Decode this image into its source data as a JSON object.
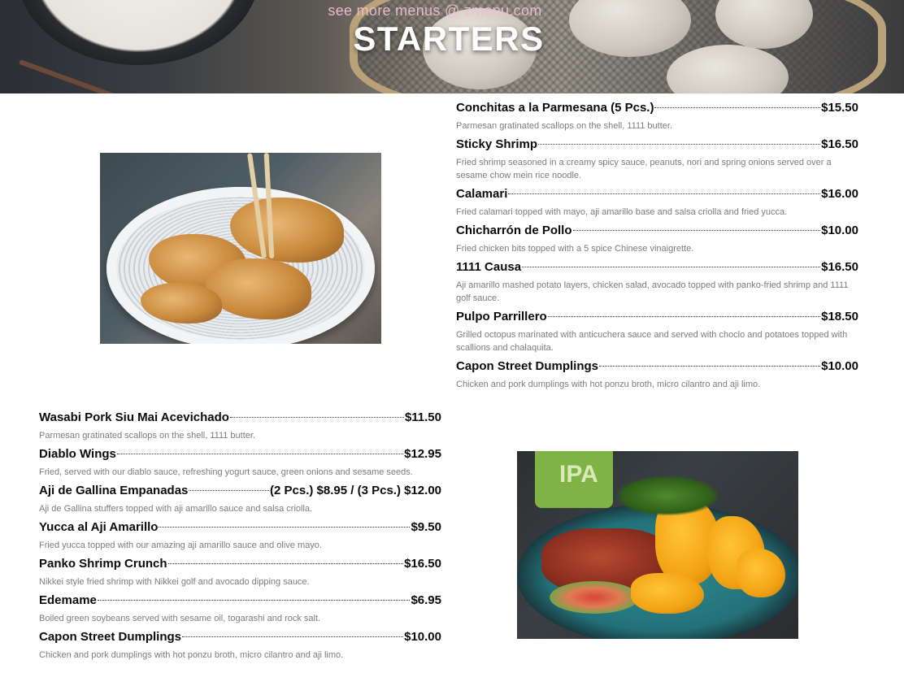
{
  "header": {
    "watermark": "see more menus @ zmenu.com",
    "title": "STARTERS"
  },
  "right_menu": [
    {
      "name": "Conchitas a la Parmesana (5 Pcs.)",
      "price": "$15.50",
      "desc": "Parmesan gratinated scallops on the shell, 1111 butter."
    },
    {
      "name": "Sticky Shrimp",
      "price": "$16.50",
      "desc": "Fried shrimp seasoned in a creamy spicy sauce, peanuts, nori and spring onions served over a sesame chow mein rice noodle."
    },
    {
      "name": "Calamari",
      "price": "$16.00",
      "desc": "Fried calamari topped with mayo, aji amarillo base and salsa criolla and fried yucca."
    },
    {
      "name": "Chicharrón de Pollo",
      "price": "$10.00",
      "desc": "Fried chicken bits topped with a 5 spice Chinese vinaigrette."
    },
    {
      "name": "1111 Causa",
      "price": "$16.50",
      "desc": "Aji amarillo mashed potato layers, chicken salad, avocado topped with panko-fried shrimp and 1111 golf sauce."
    },
    {
      "name": "Pulpo Parrillero",
      "price": "$18.50",
      "desc": "Grilled octopus marinated with anticuchera sauce and served with choclo and potatoes topped with scallions and chalaquita."
    },
    {
      "name": "Capon Street Dumplings",
      "price": "$10.00",
      "desc": "Chicken and pork dumplings with hot ponzu broth, micro cilantro and aji limo."
    }
  ],
  "left_menu": [
    {
      "name": "Wasabi Pork Siu Mai Acevichado",
      "price": "$11.50",
      "desc": "Parmesan gratinated scallops on the shell, 1111 butter."
    },
    {
      "name": "Diablo Wings",
      "price": "$12.95",
      "desc": "Fried, served with our diablo sauce, refreshing yogurt sauce, green onions and sesame seeds."
    },
    {
      "name": "Aji de Gallina Empanadas",
      "price": "(2 Pcs.) $8.95 / (3 Pcs.) $12.00",
      "desc": "Aji de Gallina stuffers topped with aji amarillo sauce and salsa criolla."
    },
    {
      "name": "Yucca al Aji Amarillo",
      "price": "$9.50",
      "desc": "Fried yucca topped with our amazing aji amarillo sauce and olive mayo."
    },
    {
      "name": "Panko Shrimp Crunch",
      "price": "$16.50",
      "desc": "Nikkei style fried shrimp with Nikkei golf and avocado dipping sauce."
    },
    {
      "name": "Edemame",
      "price": "$6.95",
      "desc": "Boiled green soybeans served with sesame oil, togarashi and rock salt."
    },
    {
      "name": "Capon Street Dumplings",
      "price": "$10.00",
      "desc": "Chicken and pork dumplings with hot ponzu broth, micro cilantro and aji limo."
    }
  ],
  "photos": {
    "dumplings_photo": "gyoza-bowl-image",
    "ceviche_photo": "nikkei-dish-image",
    "can_label": "IPA"
  }
}
